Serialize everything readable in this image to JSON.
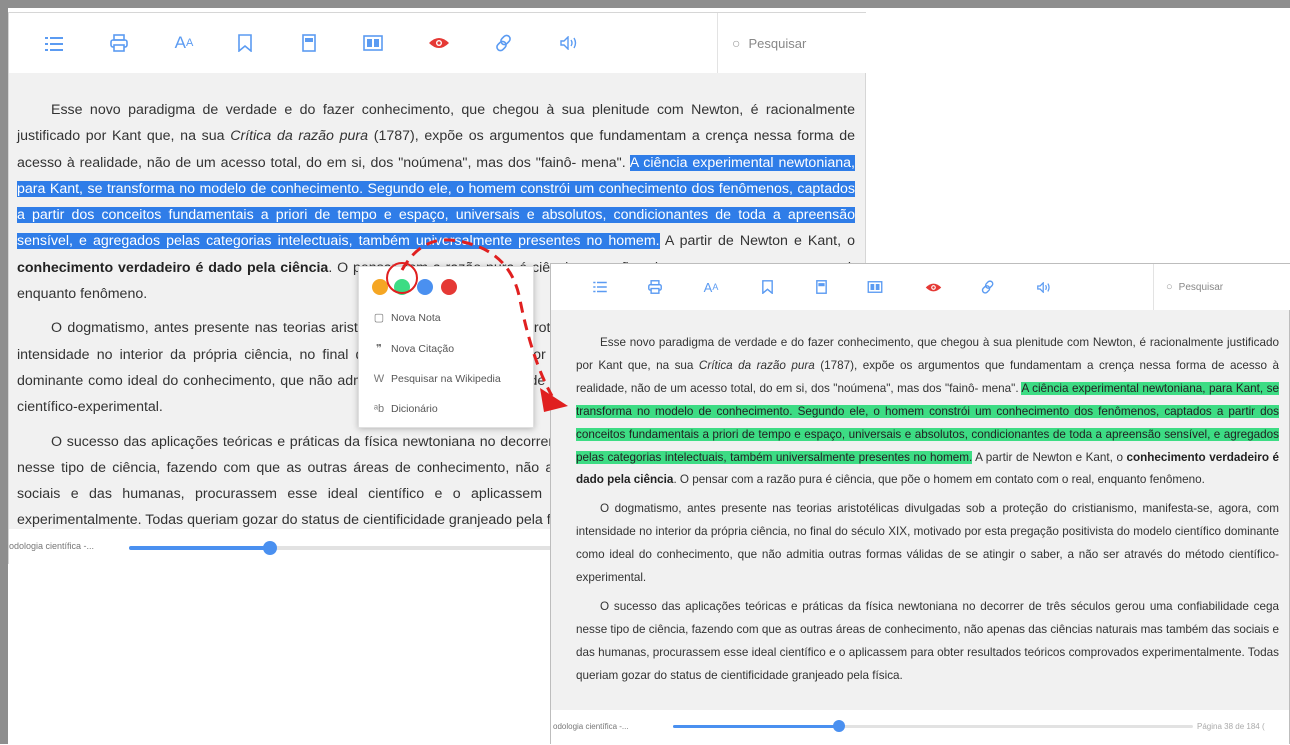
{
  "toolbar": {
    "icons": [
      "list-icon",
      "print-icon",
      "font-size-icon",
      "bookmark-icon",
      "page-icon",
      "slides-icon",
      "eye-icon",
      "link-icon",
      "audio-icon"
    ],
    "search_placeholder": "Pesquisar",
    "accent_color": "#4a90f0",
    "eye_color": "#e53935"
  },
  "reader": {
    "paragraphs": [
      {
        "before": "Esse novo paradigma de verdade e do fazer conhecimento, que chegou à sua plenitude com Newton, é racionalmente justificado por Kant que, na sua ",
        "italic": "Crítica da razão pura",
        "after": " (1787), expõe os argumentos que fundamentam a crença nessa forma de acesso à realidade, não de um acesso total, do em si, dos \"noúmena\", mas dos \"fainô- mena\". ",
        "highlight": "A ciência experimental newtoniana, para Kant, se transforma no modelo de conhecimento. Segundo ele, o homem constrói um conhecimento dos fenômenos, captados a partir dos conceitos fundamentais a priori de tempo e espaço, universais e absolutos, condicionantes de toda a apreensão sensível, e agregados pelas categorias intelectuais, também universalmente presentes no homem.",
        "mid": " A partir de Newton e Kant, o ",
        "bold": "conhecimento verdadeiro é dado pela ciência",
        "end": ". O pensar com a razão pura é ciência, que põe o homem em contato com o real, enquanto fenômeno."
      },
      {
        "text": "O dogmatismo, antes presente nas teorias aristotélicas divulgadas sob a proteção do cristianismo, manifesta-se, agora, com intensidade no interior da própria ciência, no final do século XIX, motivado por esta pregação positivista do modelo científico dominante como ideal do conhecimento, que não admitia outras formas válidas de se atingir o saber, a não ser através do método científico-experimental."
      },
      {
        "text": "O sucesso das aplicações teóricas e práticas da física newtoniana no decorrer de três séculos gerou uma confiabilidade cega nesse tipo de ciência, fazendo com que as outras áreas de conhecimento, não apenas das ciências naturais mas também das sociais e das humanas, procurassem esse ideal científico e o aplicassem para obter resultados teóricos comprovados experimentalmente. Todas queriam gozar do status de cientificidade granjeado pela física."
      }
    ],
    "footer_title": "odologia científica -...",
    "footer_page": "Página 38 de 184 (",
    "progress": 0.32
  },
  "context_menu": {
    "colors": [
      "#f5a623",
      "#3ddc84",
      "#4a90f0",
      "#e53935"
    ],
    "selected_color": "#3ddc84",
    "items": [
      {
        "icon": "note-icon",
        "glyph": "▢",
        "label": "Nova Nota"
      },
      {
        "icon": "quote-icon",
        "glyph": "❞",
        "label": "Nova Citação"
      },
      {
        "icon": "wikipedia-icon",
        "glyph": "W",
        "label": "Pesquisar na Wikipedia"
      },
      {
        "icon": "dictionary-icon",
        "glyph": "ᵃb",
        "label": "Dicionário"
      }
    ]
  },
  "annotation": {
    "ring_color": "#e02020",
    "arrow_color": "#e02020"
  }
}
